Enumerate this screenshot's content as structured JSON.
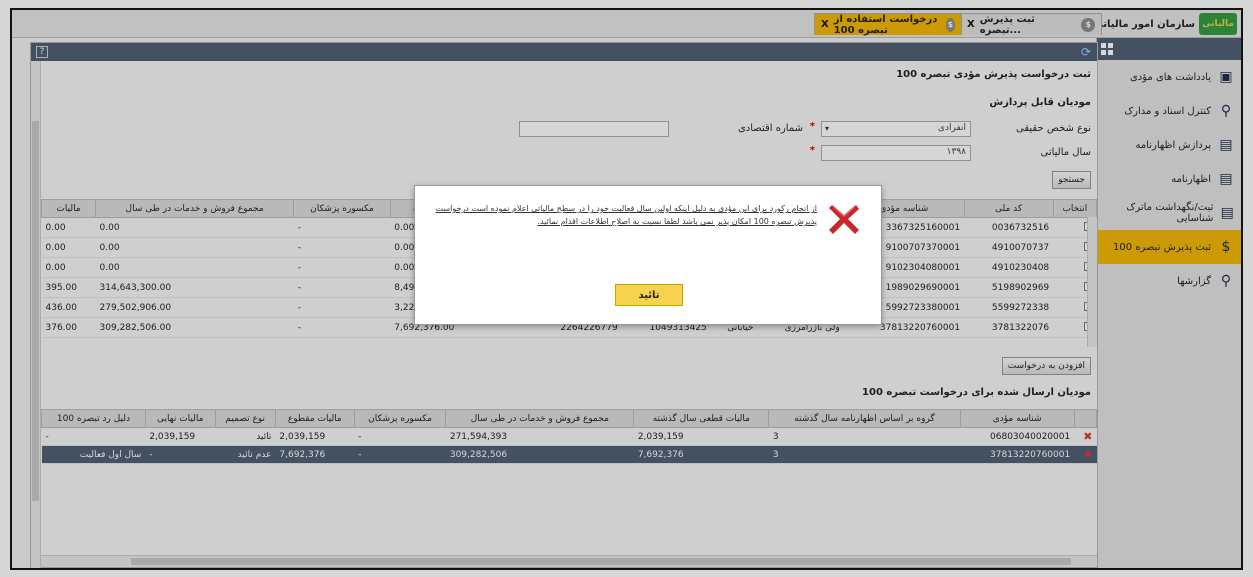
{
  "app": {
    "title": "سازمان امور مالیاتی کشور",
    "logo_text": "مالیاتی"
  },
  "tabs": [
    {
      "label": "ثبت پذیرش تبصره...",
      "close": "X"
    },
    {
      "label": "درخواست استفاده از تبصره 100",
      "close": "X"
    }
  ],
  "sidebar": {
    "items": [
      {
        "label": "یادداشت های مؤدی"
      },
      {
        "label": "کنترل اسناد و مدارک"
      },
      {
        "label": "پردازش اظهارنامه"
      },
      {
        "label": "اظهارنامه"
      },
      {
        "label": "ثبت/نگهداشت ماترک شناسایی"
      },
      {
        "label": "ثبت پذیرش تبصره 100"
      },
      {
        "label": "گزارشها"
      }
    ]
  },
  "form": {
    "page_title": "ثبت درخواست پذیرش مؤدی تبصره 100",
    "section_title": "مودیان قابل پردازش",
    "person_type_label": "نوع شخص حقیقی",
    "person_type_value": "انفرادی",
    "economic_code_label": "شماره اقتصادی",
    "economic_code_value": "",
    "tax_year_label": "سال مالیاتی",
    "tax_year_value": "۱۳۹۸",
    "search_button": "جستجو"
  },
  "table1": {
    "columns": [
      "انتخاب",
      "کد ملی",
      "شناسه مؤدی",
      "",
      "",
      "",
      "",
      "مالیات قطعی سال گذشته",
      "مکسوره پزشکان",
      "مجموع فروش و خدمات در طی سال",
      "مالیات"
    ],
    "rows": [
      {
        "national_code": "0036732516",
        "taxpayer_id": "3367325160001",
        "role": "",
        "address": "",
        "code_a": "",
        "code_b": "",
        "final_tax": "0.00",
        "doctors": "-",
        "total_sales": "0.00",
        "tax": "0.00"
      },
      {
        "national_code": "4910070737",
        "taxpayer_id": "9100707370001",
        "role": "",
        "address": "",
        "code_a": "",
        "code_b": "",
        "final_tax": "0.00",
        "doctors": "-",
        "total_sales": "0.00",
        "tax": "0.00"
      },
      {
        "national_code": "4910230408",
        "taxpayer_id": "9102304080001",
        "role": "",
        "address": "",
        "code_a": "",
        "code_b": "",
        "final_tax": "0.00",
        "doctors": "-",
        "total_sales": "0.00",
        "tax": "0.00"
      },
      {
        "national_code": "5198902969",
        "taxpayer_id": "1989029690001",
        "role": "",
        "address": "",
        "code_a": "",
        "code_b": "",
        "final_tax": "8,496,495.00",
        "doctors": "-",
        "total_sales": "314,643,300.00",
        "tax": "395.00"
      },
      {
        "national_code": "5599272338",
        "taxpayer_id": "5992723380001",
        "role": "",
        "address": "",
        "code_a": "",
        "code_b": "",
        "final_tax": "3,225,436.00",
        "doctors": "-",
        "total_sales": "279,502,906.00",
        "tax": "436.00"
      },
      {
        "national_code": "3781322076",
        "taxpayer_id": "37813220760001",
        "role": "ولی بازرامرزی",
        "address": "خیابانی",
        "code_a": "1049313425",
        "code_b": "2264226779",
        "final_tax": "7,692,376.00",
        "doctors": "-",
        "total_sales": "309,282,506.00",
        "tax": "376.00"
      }
    ]
  },
  "add_button": "افزودن به درخواست",
  "sent_section_title": "مودیان ارسال شده برای درخواست تبصره 100",
  "table2": {
    "columns": [
      "",
      "شناسه مؤدی",
      "گروه بر اساس اظهارنامه سال گذشته",
      "مالیات قطعی سال گذشته",
      "مجموع فروش و خدمات در طی سال",
      "مکسوره پزشکان",
      "مالیات مقطوع",
      "نوع تصمیم",
      "مالیات نهایی",
      "دلیل رد تبصره 100"
    ],
    "rows": [
      {
        "taxpayer_id": "06803040020001",
        "group": "3",
        "final_tax": "2,039,159",
        "total_sales": "271,594,393",
        "doctors": "-",
        "fixed_tax": "2,039,159",
        "decision": "تائید",
        "final": "2,039,159",
        "reason": "-"
      },
      {
        "taxpayer_id": "37813220760001",
        "group": "3",
        "final_tax": "7,692,376",
        "total_sales": "309,282,506",
        "doctors": "-",
        "fixed_tax": "7,692,376",
        "decision": "عدم تائید",
        "final": "-",
        "reason": "سال اول فعالیت"
      }
    ]
  },
  "dialog": {
    "message": "از انجام رکورد برای این مؤدی به دلیل اینکه اولین سال فعالیت خود را در سطح مالیاتی اعلام نموده است درخواست پذیرش تبصره 100 امکان پذیر نمی باشد لطفا نسبت به اصلاح اطلاعات اقدام نمائید.",
    "confirm": "تائید"
  }
}
